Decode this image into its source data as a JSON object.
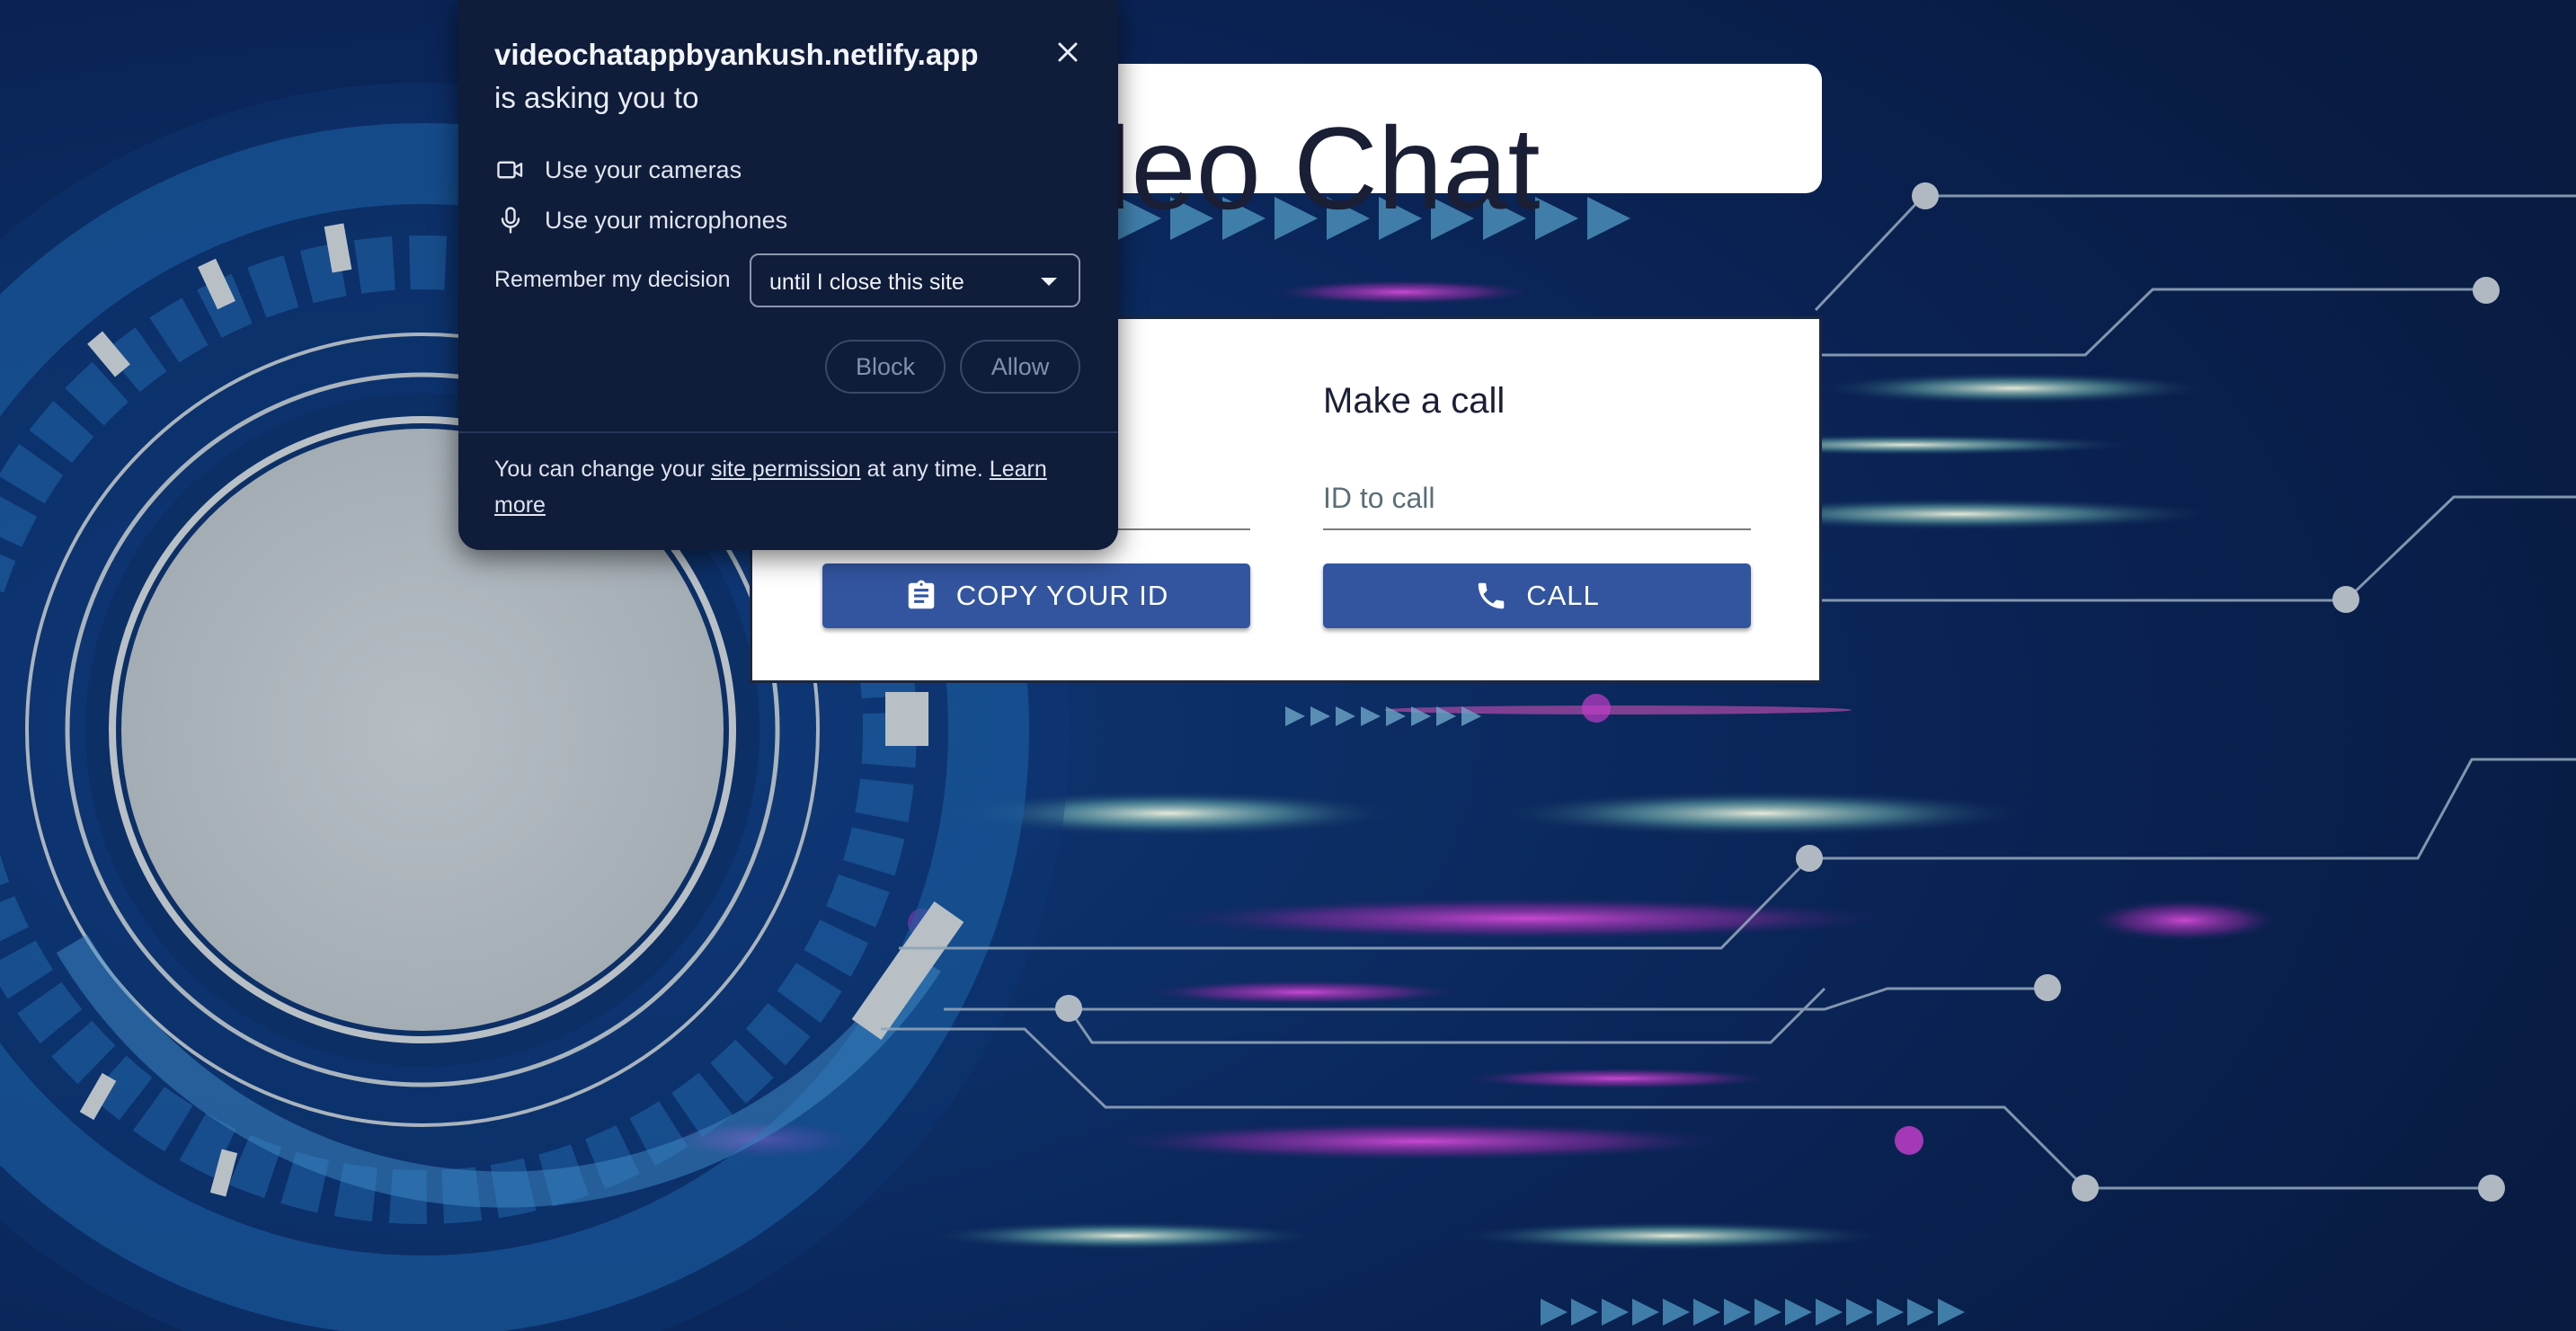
{
  "colors": {
    "background": "#0b1f4a",
    "card": "#ffffff",
    "button": "#3355a0",
    "popup": "#0f1c3a",
    "accent_magenta": "#c03cc8"
  },
  "app": {
    "title": "deo Chat"
  },
  "call_panel": {
    "heading": "Make a call",
    "id_placeholder": "ID to call",
    "copy_button": {
      "label": "COPY YOUR ID",
      "icon": "clipboard-icon"
    },
    "call_button": {
      "label": "CALL",
      "icon": "phone-icon"
    }
  },
  "permission_popup": {
    "site": "videochatappbyankush.netlify.app",
    "asking": "is asking you to",
    "permissions": [
      {
        "icon": "camera-icon",
        "label": "Use your cameras"
      },
      {
        "icon": "microphone-icon",
        "label": "Use your microphones"
      }
    ],
    "remember_label": "Remember my decision",
    "remember_value": "until I close this site",
    "block_label": "Block",
    "allow_label": "Allow",
    "footer": {
      "prefix": "You can change your ",
      "link1": "site permission",
      "middle": " at any time. ",
      "link2": "Learn more"
    },
    "close_icon": "close-icon"
  }
}
